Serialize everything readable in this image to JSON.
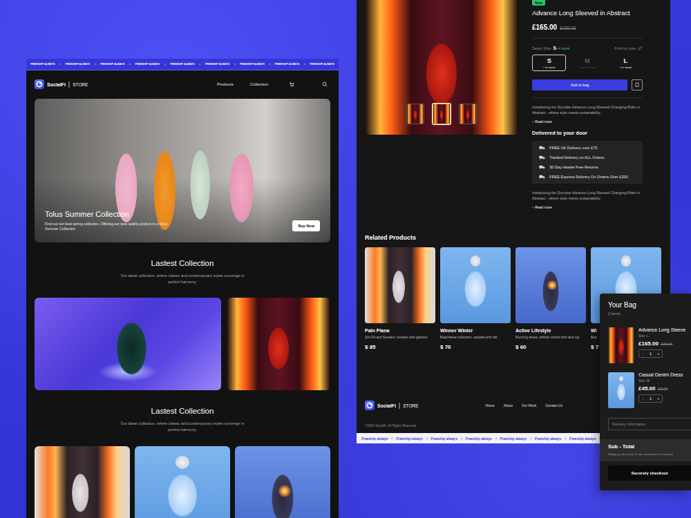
{
  "left_page": {
    "marquee": {
      "items": [
        "FREESHIP ALWAYS",
        "FREESHIP ALWAYS",
        "FREESHIP ALWAYS",
        "FREESHIP ALWAYS",
        "FREESHIP ALWAYS",
        "FREESHIP ALWAYS",
        "FREESHIP ALWAYS",
        "FREESHIP ALWAYS",
        "FREESHIP ALWAYS"
      ],
      "separator": "✧"
    },
    "brand": {
      "name": "SocialFi",
      "divider": "|",
      "store": "STORE"
    },
    "nav": [
      "Products",
      "Collection"
    ],
    "hero": {
      "title": "Tolus Summer Collection",
      "text": "Find out our best spring collection. Offering our best quality product in a Tolus Summer Collection",
      "button": "Buy Now"
    },
    "sections": [
      {
        "title": "Lastest Collection",
        "text": "Our latest collection, where classic and contemporary styles converge in perfect harmony."
      },
      {
        "title": "Lastest Collection",
        "text": "Our latest collection, where classic and contemporary styles converge in perfect harmony."
      }
    ]
  },
  "product_page": {
    "badge": "New",
    "title": "Advance Long Sleeved in Abstract",
    "price": "£165.00",
    "old_price": "£180.00",
    "thumbnails": [
      {
        "selected": false
      },
      {
        "selected": true
      },
      {
        "selected": false
      }
    ],
    "size_select": {
      "label": "Select Size:",
      "value": "S",
      "stock": "• in stock",
      "help": "Find my size"
    },
    "sizes": [
      {
        "label": "S",
        "stock": "• in stock",
        "selected": true,
        "disabled": false
      },
      {
        "label": "M",
        "stock": "• out of stock",
        "selected": false,
        "disabled": true
      },
      {
        "label": "L",
        "stock": "• in stock",
        "selected": false,
        "disabled": false
      }
    ],
    "add_button": "Add to bag",
    "intro": {
      "text": "Introducing the Drynobe Advance Long Sleeved Changing Robe in Abstract - where style meets sustainability.",
      "link": "– Read more"
    },
    "delivery": {
      "title": "Delivered to your door",
      "items": [
        "FREE UK Delivery over £75",
        "Tracked Delivery on ALL Orders",
        "30 Day Hassle Free Returns",
        "FREE Express Delivery On Orders Over £200"
      ]
    },
    "outro": {
      "text": "Introducing the Drynobe Advance Long Sleeved Changing Robe in Abstract - where style meets sustainability.",
      "link": "– Read more"
    }
  },
  "related": {
    "title": "Related Products",
    "items": [
      {
        "name": "Pain Plana",
        "text": "Sim-Fit and Sneaker, hoodies with glasses",
        "price": "$ 85"
      },
      {
        "name": "Winner Winter",
        "text": "Beachwear collection, sandals with hat",
        "price": "$ 70"
      },
      {
        "name": "Active Lifestyle",
        "text": "Running shoes, athletic shorts with tank top",
        "price": "$ 60"
      },
      {
        "name": "Wi",
        "text": "Bea",
        "price": "$ 7"
      }
    ]
  },
  "footer": {
    "brand": {
      "name": "SocialFi",
      "divider": "|",
      "store": "STORE"
    },
    "links": [
      "Home",
      "About",
      "Our Work",
      "Contact Us"
    ],
    "copyright": "©2024 SocialFi. All Rights Reserved.",
    "marquee": {
      "items": [
        "Freeship always",
        "Freeship always",
        "Freeship always",
        "Freeship always",
        "Freeship always",
        "Freeship always",
        "Freeship always",
        "Freeship always",
        "Freeship always"
      ],
      "separator": "✧"
    }
  },
  "bag": {
    "title": "Your Bag",
    "count": "2 items",
    "items": [
      {
        "name": "Advance Long Sleeve",
        "size": "Size: L",
        "price": "£165.00",
        "old_price": "£180.00",
        "minus": "-",
        "qty": "1",
        "plus": "+"
      },
      {
        "name": "Casual Denim Dress",
        "size": "Size: M",
        "price": "£45.00",
        "old_price": "£50.00",
        "minus": "-",
        "qty": "1",
        "plus": "+"
      }
    ],
    "field_placeholder": "Delivery information",
    "subtotal": {
      "label": "Sub - Total",
      "note": "Shipping, discounts & tax calculated at checkout"
    },
    "checkout": "Securely checkout"
  }
}
